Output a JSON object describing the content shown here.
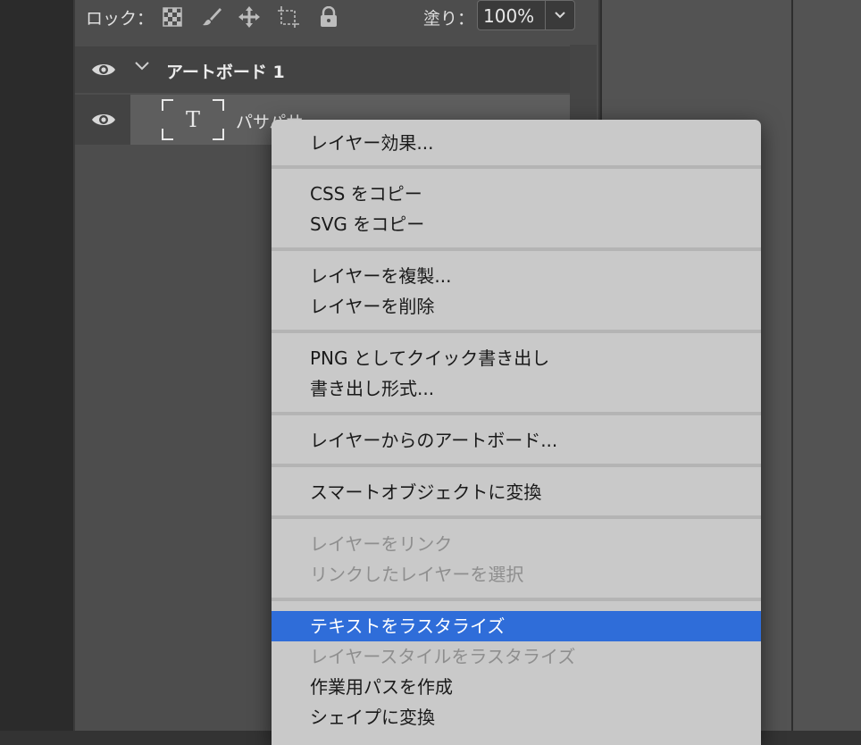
{
  "lock_bar": {
    "lock_label": "ロック：",
    "fill_label": "塗り：",
    "fill_value": "100%"
  },
  "layers": {
    "artboard_name": "アートボード 1",
    "text_layer_name": "パサパサ"
  },
  "context_menu": {
    "items": [
      {
        "label": "レイヤー効果...",
        "enabled": true
      },
      {
        "label": "CSS をコピー",
        "enabled": true
      },
      {
        "label": "SVG をコピー",
        "enabled": true
      },
      {
        "label": "レイヤーを複製...",
        "enabled": true
      },
      {
        "label": "レイヤーを削除",
        "enabled": true
      },
      {
        "label": "PNG としてクイック書き出し",
        "enabled": true
      },
      {
        "label": "書き出し形式...",
        "enabled": true
      },
      {
        "label": "レイヤーからのアートボード...",
        "enabled": true
      },
      {
        "label": "スマートオブジェクトに変換",
        "enabled": true
      },
      {
        "label": "レイヤーをリンク",
        "enabled": false
      },
      {
        "label": "リンクしたレイヤーを選択",
        "enabled": false
      },
      {
        "label": "テキストをラスタライズ",
        "enabled": true,
        "highlighted": true
      },
      {
        "label": "レイヤースタイルをラスタライズ",
        "enabled": false
      },
      {
        "label": "作業用パスを作成",
        "enabled": true
      },
      {
        "label": "シェイプに変換",
        "enabled": true
      }
    ]
  },
  "colors": {
    "highlight": "#2f6dd9",
    "menu_bg": "#c9c9c9",
    "panel_bg": "#4d4d4d"
  }
}
